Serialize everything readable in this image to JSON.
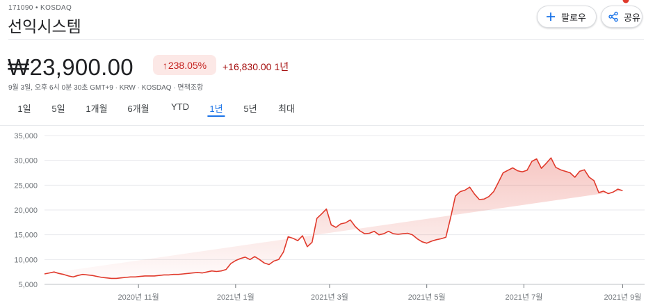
{
  "header": {
    "ticker": "171090 • KOSDAQ",
    "name": "선익시스템",
    "follow_label": "팔로우",
    "share_label": "공유",
    "follow_icon": "plus-icon",
    "share_icon": "share-icon"
  },
  "quote": {
    "price": "₩23,900.00",
    "percent_change": "238.05%",
    "percent_arrow": "↑",
    "abs_change": "+16,830.00",
    "period": "1년",
    "meta": "9월 3일, 오후 6시 0분 30초 GMT+9 · KRW · KOSDAQ · 면책조항",
    "colors": {
      "down_badge_bg": "#fce8e6",
      "change_text": "#c5221f",
      "line": "#e0392b"
    }
  },
  "range_tabs": {
    "items": [
      "1일",
      "5일",
      "1개월",
      "6개월",
      "YTD",
      "1년",
      "5년",
      "최대"
    ],
    "active": "1년"
  },
  "chart_data": {
    "type": "area",
    "ylim": [
      5000,
      35000
    ],
    "yticks": [
      5000,
      10000,
      15000,
      20000,
      25000,
      30000,
      35000
    ],
    "ytick_labels": [
      "5,000",
      "10,000",
      "15,000",
      "20,000",
      "25,000",
      "30,000",
      "35,000"
    ],
    "xtick_labels": [
      "2020년 11월",
      "2021년 1월",
      "2021년 3월",
      "2021년 5월",
      "2021년 7월",
      "2021년 9월"
    ],
    "xtick_dates": [
      "2020-11-01",
      "2021-01-01",
      "2021-03-01",
      "2021-05-01",
      "2021-07-01",
      "2021-09-01"
    ],
    "x": [
      "2020-09-03",
      "2020-09-06",
      "2020-09-09",
      "2020-09-12",
      "2020-09-15",
      "2020-09-18",
      "2020-09-21",
      "2020-09-24",
      "2020-09-27",
      "2020-09-30",
      "2020-10-03",
      "2020-10-06",
      "2020-10-09",
      "2020-10-12",
      "2020-10-15",
      "2020-10-18",
      "2020-10-21",
      "2020-10-24",
      "2020-10-27",
      "2020-10-30",
      "2020-11-02",
      "2020-11-05",
      "2020-11-08",
      "2020-11-11",
      "2020-11-14",
      "2020-11-17",
      "2020-11-20",
      "2020-11-23",
      "2020-11-26",
      "2020-11-29",
      "2020-12-02",
      "2020-12-05",
      "2020-12-08",
      "2020-12-11",
      "2020-12-14",
      "2020-12-17",
      "2020-12-20",
      "2020-12-23",
      "2020-12-26",
      "2020-12-29",
      "2021-01-01",
      "2021-01-04",
      "2021-01-07",
      "2021-01-10",
      "2021-01-13",
      "2021-01-16",
      "2021-01-19",
      "2021-01-22",
      "2021-01-25",
      "2021-01-28",
      "2021-01-31",
      "2021-02-03",
      "2021-02-06",
      "2021-02-09",
      "2021-02-12",
      "2021-02-15",
      "2021-02-18",
      "2021-02-21",
      "2021-02-24",
      "2021-02-27",
      "2021-03-02",
      "2021-03-05",
      "2021-03-08",
      "2021-03-11",
      "2021-03-14",
      "2021-03-17",
      "2021-03-20",
      "2021-03-23",
      "2021-03-26",
      "2021-03-29",
      "2021-04-01",
      "2021-04-04",
      "2021-04-07",
      "2021-04-10",
      "2021-04-13",
      "2021-04-16",
      "2021-04-19",
      "2021-04-22",
      "2021-04-25",
      "2021-04-28",
      "2021-05-01",
      "2021-05-04",
      "2021-05-07",
      "2021-05-10",
      "2021-05-13",
      "2021-05-16",
      "2021-05-19",
      "2021-05-22",
      "2021-05-25",
      "2021-05-28",
      "2021-05-31",
      "2021-06-03",
      "2021-06-06",
      "2021-06-09",
      "2021-06-12",
      "2021-06-15",
      "2021-06-18",
      "2021-06-21",
      "2021-06-24",
      "2021-06-27",
      "2021-06-30",
      "2021-07-03",
      "2021-07-06",
      "2021-07-09",
      "2021-07-12",
      "2021-07-15",
      "2021-07-18",
      "2021-07-21",
      "2021-07-24",
      "2021-07-27",
      "2021-07-30",
      "2021-08-02",
      "2021-08-05",
      "2021-08-08",
      "2021-08-11",
      "2021-08-14",
      "2021-08-17",
      "2021-08-20",
      "2021-08-23",
      "2021-08-26",
      "2021-08-29",
      "2021-09-01",
      "2021-09-03"
    ],
    "series": [
      {
        "values": [
          7100,
          7300,
          7500,
          7200,
          7000,
          6700,
          6500,
          6800,
          7000,
          6900,
          6800,
          6600,
          6400,
          6300,
          6200,
          6200,
          6300,
          6400,
          6500,
          6500,
          6600,
          6700,
          6700,
          6700,
          6800,
          6900,
          6900,
          7000,
          7000,
          7100,
          7200,
          7300,
          7400,
          7300,
          7500,
          7700,
          7600,
          7700,
          8000,
          9200,
          9800,
          10200,
          10500,
          10000,
          10600,
          10000,
          9300,
          9000,
          9700,
          10000,
          11500,
          14600,
          14300,
          13800,
          14800,
          12600,
          13500,
          18300,
          19200,
          20200,
          17000,
          16500,
          17200,
          17400,
          18000,
          16700,
          15800,
          15200,
          15300,
          15700,
          15000,
          15200,
          15700,
          15200,
          15100,
          15200,
          15300,
          15000,
          14200,
          13600,
          13300,
          13700,
          14000,
          14200,
          14500,
          18500,
          22800,
          23700,
          24000,
          24600,
          23200,
          22100,
          22200,
          22700,
          23700,
          25600,
          27500,
          28000,
          28500,
          27900,
          27700,
          28000,
          29800,
          30300,
          28400,
          29400,
          30500,
          28600,
          28100,
          27800,
          27500,
          26600,
          27800,
          28100,
          26600,
          25900,
          23500,
          23800,
          23300,
          23600,
          24200,
          23900
        ]
      }
    ]
  }
}
